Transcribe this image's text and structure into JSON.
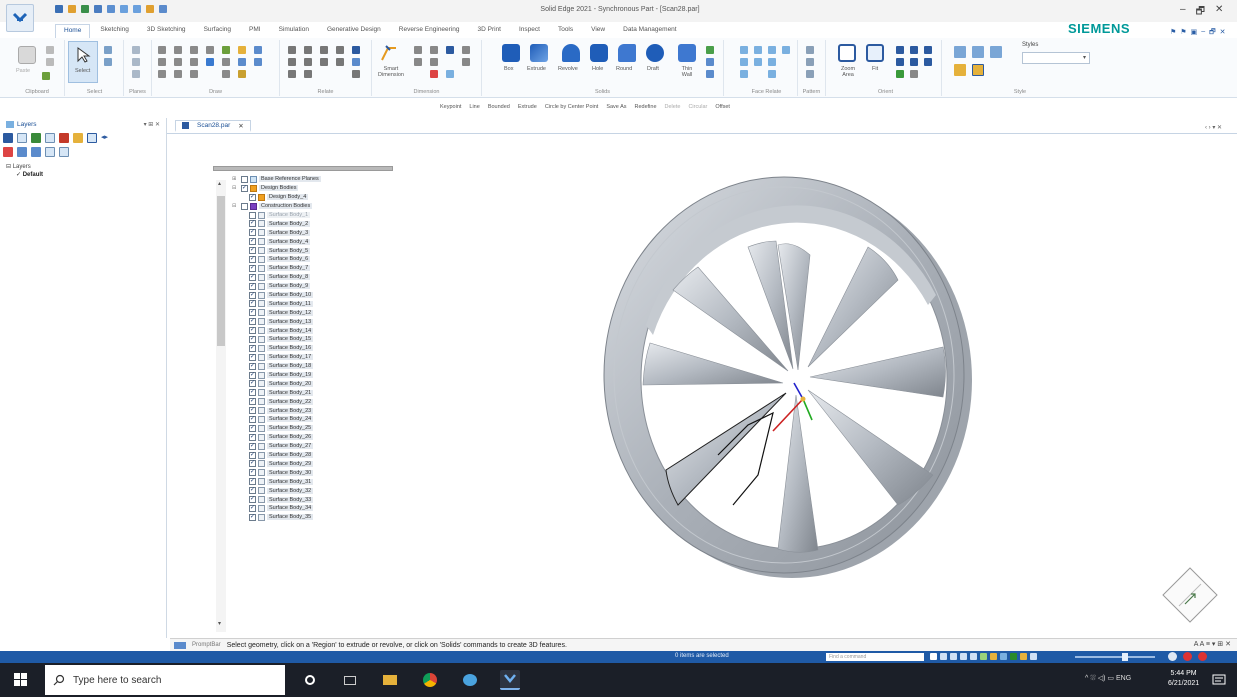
{
  "window": {
    "title": "Solid Edge 2021 - Synchronous Part - [Scan28.par]",
    "brand": "SIEMENS",
    "controls": [
      "–",
      "🗗",
      "✕"
    ]
  },
  "tabs": [
    "Home",
    "Sketching",
    "3D Sketching",
    "Surfacing",
    "PMI",
    "Simulation",
    "Generative Design",
    "Reverse Engineering",
    "3D Print",
    "Inspect",
    "Tools",
    "View",
    "Data Management"
  ],
  "ribbon": {
    "groups": [
      "Clipboard",
      "Select",
      "Planes",
      "Draw",
      "Relate",
      "Dimension",
      "Solids",
      "Face Relate",
      "Pattern",
      "Orient",
      "Style"
    ],
    "labels": {
      "paste": "Paste",
      "select": "Select",
      "smart_dimension": "Smart Dimension",
      "box": "Box",
      "extrude": "Extrude",
      "revolve": "Revolve",
      "hole": "Hole",
      "round": "Round",
      "draft": "Draft",
      "thin_wall": "Thin Wall",
      "zoom_area": "Zoom Area",
      "fit": "Fit",
      "styles": "Styles"
    }
  },
  "command_bar": [
    "Keypoint",
    "Line",
    "Bounded",
    "Extrude",
    "Circle by Center Point",
    "Save As",
    "Redefine",
    "Delete",
    "Circular",
    "Offset"
  ],
  "left_panel": {
    "title": "Layers",
    "pin": "▾ ⊞ ✕",
    "tree_root": "Layers",
    "tree_default": "Default"
  },
  "document": {
    "tab": "Scan28.par",
    "close": "✕",
    "view_controls": "‹ › ▾ ✕"
  },
  "pathfinder": {
    "rows": [
      {
        "exp": "⊞",
        "cb": false,
        "icon": "ref",
        "label": "Base Reference Planes",
        "muted": false,
        "indent": 0
      },
      {
        "exp": "⊟",
        "cb": true,
        "icon": "body",
        "label": "Design Bodies",
        "muted": false,
        "indent": 0
      },
      {
        "exp": "",
        "cb": true,
        "icon": "body",
        "label": "Design Body_4",
        "muted": false,
        "indent": 1
      },
      {
        "exp": "⊟",
        "cb": false,
        "icon": "cons",
        "label": "Construction Bodies",
        "muted": false,
        "indent": 0
      },
      {
        "exp": "",
        "cb": false,
        "icon": "plain",
        "label": "Surface Body_1",
        "muted": true,
        "indent": 1
      },
      {
        "exp": "",
        "cb": true,
        "icon": "plain",
        "label": "Surface Body_2",
        "muted": false,
        "indent": 1
      },
      {
        "exp": "",
        "cb": true,
        "icon": "plain",
        "label": "Surface Body_3",
        "muted": false,
        "indent": 1
      },
      {
        "exp": "",
        "cb": true,
        "icon": "plain",
        "label": "Surface Body_4",
        "muted": false,
        "indent": 1
      },
      {
        "exp": "",
        "cb": true,
        "icon": "plain",
        "label": "Surface Body_5",
        "muted": false,
        "indent": 1
      },
      {
        "exp": "",
        "cb": true,
        "icon": "plain",
        "label": "Surface Body_6",
        "muted": false,
        "indent": 1
      },
      {
        "exp": "",
        "cb": true,
        "icon": "plain",
        "label": "Surface Body_7",
        "muted": false,
        "indent": 1
      },
      {
        "exp": "",
        "cb": true,
        "icon": "plain",
        "label": "Surface Body_8",
        "muted": false,
        "indent": 1
      },
      {
        "exp": "",
        "cb": true,
        "icon": "plain",
        "label": "Surface Body_9",
        "muted": false,
        "indent": 1
      },
      {
        "exp": "",
        "cb": true,
        "icon": "plain",
        "label": "Surface Body_10",
        "muted": false,
        "indent": 1
      },
      {
        "exp": "",
        "cb": true,
        "icon": "plain",
        "label": "Surface Body_11",
        "muted": false,
        "indent": 1
      },
      {
        "exp": "",
        "cb": true,
        "icon": "plain",
        "label": "Surface Body_12",
        "muted": false,
        "indent": 1
      },
      {
        "exp": "",
        "cb": true,
        "icon": "plain",
        "label": "Surface Body_13",
        "muted": false,
        "indent": 1
      },
      {
        "exp": "",
        "cb": true,
        "icon": "plain",
        "label": "Surface Body_14",
        "muted": false,
        "indent": 1
      },
      {
        "exp": "",
        "cb": true,
        "icon": "plain",
        "label": "Surface Body_15",
        "muted": false,
        "indent": 1
      },
      {
        "exp": "",
        "cb": true,
        "icon": "plain",
        "label": "Surface Body_16",
        "muted": false,
        "indent": 1
      },
      {
        "exp": "",
        "cb": true,
        "icon": "plain",
        "label": "Surface Body_17",
        "muted": false,
        "indent": 1
      },
      {
        "exp": "",
        "cb": true,
        "icon": "plain",
        "label": "Surface Body_18",
        "muted": false,
        "indent": 1
      },
      {
        "exp": "",
        "cb": true,
        "icon": "plain",
        "label": "Surface Body_19",
        "muted": false,
        "indent": 1
      },
      {
        "exp": "",
        "cb": true,
        "icon": "plain",
        "label": "Surface Body_20",
        "muted": false,
        "indent": 1
      },
      {
        "exp": "",
        "cb": true,
        "icon": "plain",
        "label": "Surface Body_21",
        "muted": false,
        "indent": 1
      },
      {
        "exp": "",
        "cb": true,
        "icon": "plain",
        "label": "Surface Body_22",
        "muted": false,
        "indent": 1
      },
      {
        "exp": "",
        "cb": true,
        "icon": "plain",
        "label": "Surface Body_23",
        "muted": false,
        "indent": 1
      },
      {
        "exp": "",
        "cb": true,
        "icon": "plain",
        "label": "Surface Body_24",
        "muted": false,
        "indent": 1
      },
      {
        "exp": "",
        "cb": true,
        "icon": "plain",
        "label": "Surface Body_25",
        "muted": false,
        "indent": 1
      },
      {
        "exp": "",
        "cb": true,
        "icon": "plain",
        "label": "Surface Body_26",
        "muted": false,
        "indent": 1
      },
      {
        "exp": "",
        "cb": true,
        "icon": "plain",
        "label": "Surface Body_27",
        "muted": false,
        "indent": 1
      },
      {
        "exp": "",
        "cb": true,
        "icon": "plain",
        "label": "Surface Body_28",
        "muted": false,
        "indent": 1
      },
      {
        "exp": "",
        "cb": true,
        "icon": "plain",
        "label": "Surface Body_29",
        "muted": false,
        "indent": 1
      },
      {
        "exp": "",
        "cb": true,
        "icon": "plain",
        "label": "Surface Body_30",
        "muted": false,
        "indent": 1
      },
      {
        "exp": "",
        "cb": true,
        "icon": "plain",
        "label": "Surface Body_31",
        "muted": false,
        "indent": 1
      },
      {
        "exp": "",
        "cb": true,
        "icon": "plain",
        "label": "Surface Body_32",
        "muted": false,
        "indent": 1
      },
      {
        "exp": "",
        "cb": true,
        "icon": "plain",
        "label": "Surface Body_33",
        "muted": false,
        "indent": 1
      },
      {
        "exp": "",
        "cb": true,
        "icon": "plain",
        "label": "Surface Body_34",
        "muted": false,
        "indent": 1
      },
      {
        "exp": "",
        "cb": true,
        "icon": "plain",
        "label": "Surface Body_35",
        "muted": false,
        "indent": 1
      }
    ]
  },
  "prompt_bar": {
    "label": "PromptBar",
    "text": "Select geometry, click on a 'Region' to extrude or revolve, or click on 'Solids' commands to create 3D features.",
    "right": "A A ≡ ▾ ⊞ ✕"
  },
  "status_bar": {
    "selected": "0 items are selected",
    "find_placeholder": "Find a command"
  },
  "taskbar": {
    "search_placeholder": "Type here to search",
    "tray": "^ ⛆ ◁) ▭ ENG",
    "time": "5:44 PM",
    "date": "6/21/2021"
  },
  "colors": {
    "accent": "#1f5aa6",
    "brand": "#009999",
    "model_gray": "#b8bcc3"
  }
}
